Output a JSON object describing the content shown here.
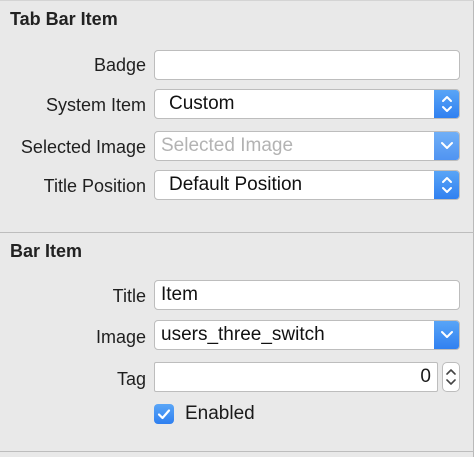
{
  "tab_bar_item": {
    "title": "Tab Bar Item",
    "badge": {
      "label": "Badge",
      "value": ""
    },
    "system_item": {
      "label": "System Item",
      "value": "Custom"
    },
    "selected_image": {
      "label": "Selected Image",
      "placeholder": "Selected Image"
    },
    "title_position": {
      "label": "Title Position",
      "value": "Default Position"
    }
  },
  "bar_item": {
    "title": "Bar Item",
    "title_field": {
      "label": "Title",
      "value": "Item"
    },
    "image": {
      "label": "Image",
      "value": "users_three_switch"
    },
    "tag": {
      "label": "Tag",
      "value": "0"
    },
    "enabled": {
      "label": "Enabled",
      "checked": true
    }
  },
  "colors": {
    "accent": "#2f7ff0",
    "panel_background": "#e9e9e9",
    "field_background": "#ffffff"
  }
}
